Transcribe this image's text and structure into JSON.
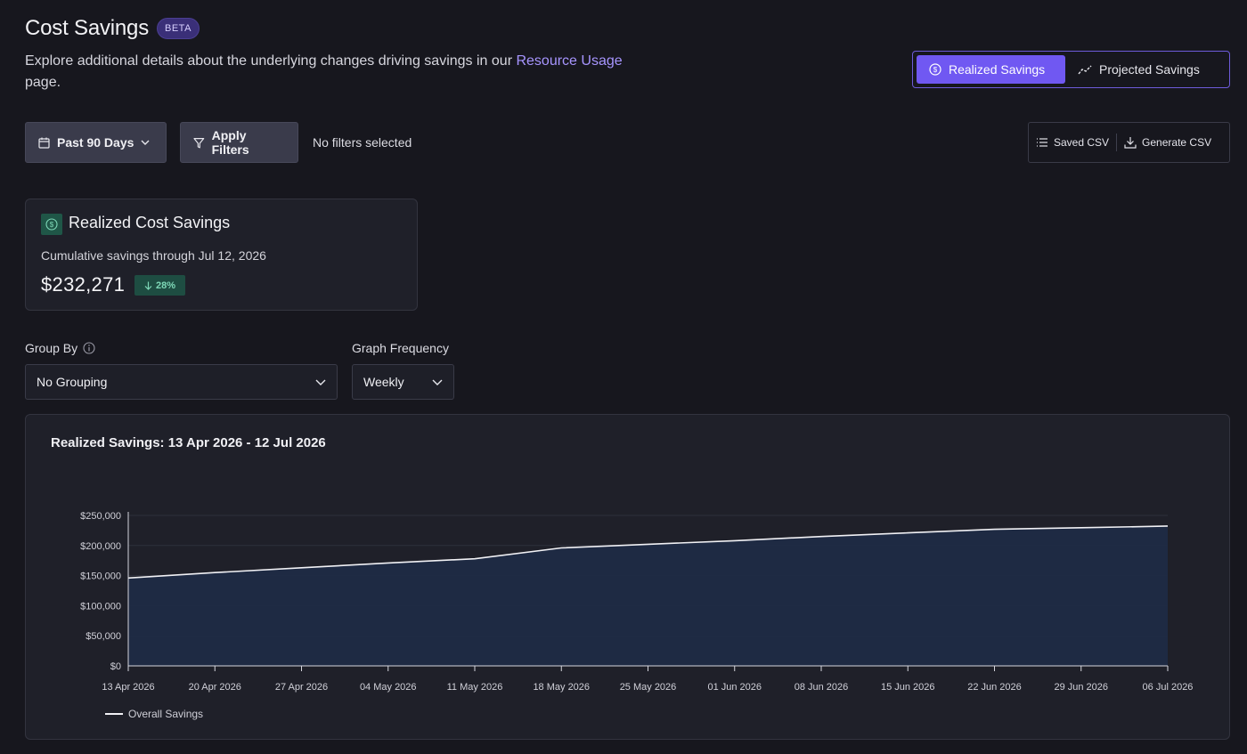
{
  "header": {
    "title": "Cost Savings",
    "badge": "BETA",
    "subtitle_before": "Explore additional details about the underlying changes driving savings in our ",
    "subtitle_link": "Resource Usage",
    "subtitle_after": " page."
  },
  "view_toggle": {
    "realized": "Realized Savings",
    "projected": "Projected Savings",
    "active": "realized"
  },
  "toolbar": {
    "date_range": "Past 90 Days",
    "apply_filters": "Apply Filters",
    "filter_status": "No filters selected",
    "saved_csv": "Saved CSV",
    "generate_csv": "Generate CSV"
  },
  "summary_card": {
    "title": "Realized Cost Savings",
    "subtitle": "Cumulative savings through Jul 12, 2026",
    "value": "$232,271",
    "delta": "28%",
    "delta_direction": "down",
    "icon": "dollar-icon"
  },
  "controls": {
    "group_by_label": "Group By",
    "group_by_value": "No Grouping",
    "frequency_label": "Graph Frequency",
    "frequency_value": "Weekly"
  },
  "colors": {
    "accent": "#7058f2",
    "link": "#a795ff",
    "area_fill": "#1f2b45",
    "line": "#f1f1f5",
    "positive": "#7ed8b7"
  },
  "chart_data": {
    "type": "area",
    "title": "Realized Savings: 13 Apr 2026 - 12 Jul 2026",
    "x": [
      "13 Apr 2026",
      "20 Apr 2026",
      "27 Apr 2026",
      "04 May 2026",
      "11 May 2026",
      "18 May 2026",
      "25 May 2026",
      "01 Jun 2026",
      "08 Jun 2026",
      "15 Jun 2026",
      "22 Jun 2026",
      "29 Jun 2026",
      "06 Jul 2026"
    ],
    "series": [
      {
        "name": "Overall Savings",
        "values": [
          146000,
          155000,
          163000,
          171000,
          178000,
          196000,
          202000,
          208000,
          215000,
          221000,
          227000,
          229500,
          232271
        ]
      }
    ],
    "y_ticks": [
      "$0",
      "$50,000",
      "$100,000",
      "$150,000",
      "$200,000",
      "$250,000"
    ],
    "ylim": [
      0,
      250000
    ],
    "grid": true,
    "legend": "bottom-left"
  }
}
